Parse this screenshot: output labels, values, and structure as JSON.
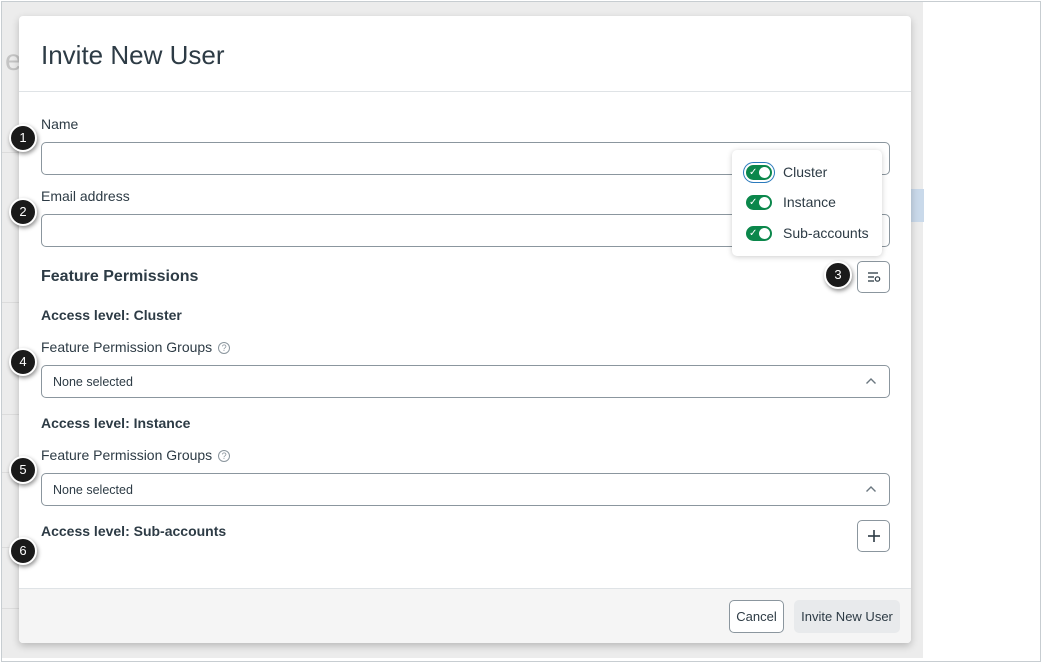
{
  "modal": {
    "title": "Invite New User",
    "name_label": "Name",
    "name_value": "",
    "email_label": "Email address",
    "email_value": "",
    "feature_permissions_title": "Feature Permissions",
    "sections": [
      {
        "access_title": "Access level: Cluster",
        "groups_label": "Feature Permission Groups",
        "select_value": "None selected"
      },
      {
        "access_title": "Access level: Instance",
        "groups_label": "Feature Permission Groups",
        "select_value": "None selected"
      },
      {
        "access_title": "Access level: Sub-accounts"
      }
    ],
    "footer": {
      "cancel_label": "Cancel",
      "invite_label": "Invite New User"
    }
  },
  "toggles": [
    {
      "label": "Cluster",
      "on": true
    },
    {
      "label": "Instance",
      "on": true
    },
    {
      "label": "Sub-accounts",
      "on": true
    }
  ],
  "callouts": [
    "1",
    "2",
    "3",
    "4",
    "5",
    "6"
  ],
  "background_glyphs": {
    "big": "e"
  },
  "colors": {
    "toggle_on": "#0b874b",
    "focus_ring": "#2b7abc",
    "text": "#2d3b45",
    "border": "#8b969e"
  },
  "icons": {
    "filter": "filter-settings-icon",
    "help": "help-circle-icon",
    "chevron": "chevron-up-icon",
    "add": "plus-icon",
    "check": "check-icon"
  }
}
